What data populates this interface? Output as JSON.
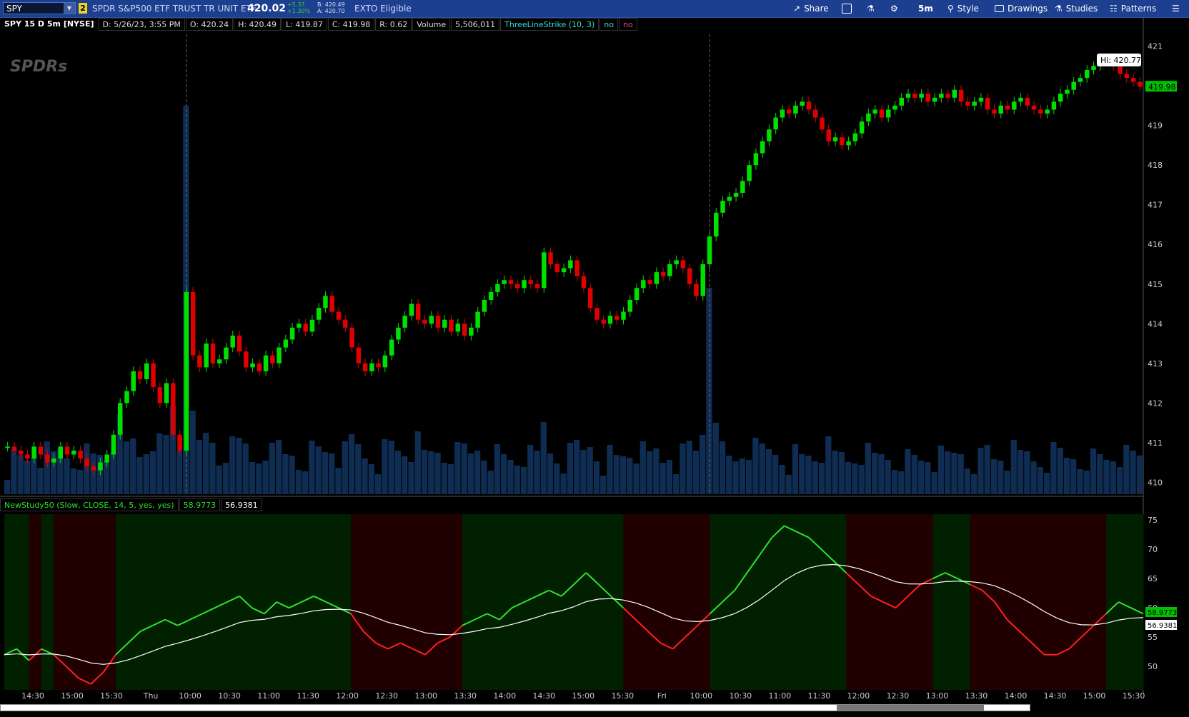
{
  "toolbar": {
    "symbol": "SPY",
    "link_badge": "2",
    "description": "SPDR S&P500 ETF TRUST TR UNIT ETF",
    "last": "420.02",
    "change": "+5.37",
    "change_pct": "+1.30%",
    "bid": "B: 420.49",
    "ask": "A: 420.70",
    "exto": "EXTO Eligible",
    "share": "Share",
    "timeframe": "5m",
    "style": "Style",
    "drawings": "Drawings",
    "studies": "Studies",
    "patterns": "Patterns"
  },
  "infobar": {
    "title": "SPY 15 D 5m [NYSE]",
    "date": "D: 5/26/23, 3:55 PM",
    "open": "O: 420.24",
    "high": "H: 420.49",
    "low": "L: 419.87",
    "close": "C: 419.98",
    "range": "R: 0.62",
    "volume_label": "Volume",
    "volume_value": "5,506,011",
    "study": "ThreeLineStrike (10, 3)",
    "flag1": "no",
    "flag2": "no"
  },
  "logo": "SPDRs",
  "hi_label": "Hi: 420.77",
  "price_tag": "419.98",
  "study_bar": {
    "name": "NewStudy50 (Slow, CLOSE, 14, 5, yes, yes)",
    "value1": "58.9773",
    "value2": "56.9381"
  },
  "colors": {
    "up": "#00e000",
    "down": "#e00000",
    "volume": "#0f2d52",
    "bg_green": "#002000",
    "bg_red": "#200000",
    "line_fast_up": "#30e030",
    "line_fast_down": "#ff2020",
    "line_slow": "#ffffff"
  },
  "chart_data": {
    "type": "candlestick",
    "price_axis": {
      "min": 409.7,
      "max": 421.3,
      "ticks": [
        "410",
        "411",
        "412",
        "413",
        "414",
        "415",
        "416",
        "417",
        "418",
        "419",
        "420",
        "421"
      ]
    },
    "study_axis": {
      "min": 46,
      "max": 76,
      "ticks": [
        "50",
        "55",
        "60",
        "65",
        "70",
        "75"
      ]
    },
    "time_labels": [
      "14:30",
      "15:00",
      "15:30",
      "Thu",
      "10:00",
      "10:30",
      "11:00",
      "11:30",
      "12:00",
      "12:30",
      "13:00",
      "13:30",
      "14:00",
      "14:30",
      "15:00",
      "15:30",
      "Fri",
      "10:00",
      "10:30",
      "11:00",
      "11:30",
      "12:00",
      "12:30",
      "13:00",
      "13:30",
      "14:00",
      "14:30",
      "15:00",
      "15:30"
    ],
    "closes": [
      410.9,
      410.8,
      410.7,
      410.6,
      410.9,
      410.7,
      410.5,
      410.6,
      410.9,
      410.7,
      410.8,
      410.6,
      410.4,
      410.3,
      410.5,
      410.7,
      411.2,
      412.0,
      412.3,
      412.8,
      412.6,
      413.0,
      412.4,
      412.0,
      412.5,
      411.2,
      410.8,
      414.8,
      413.2,
      412.9,
      413.5,
      413.0,
      413.1,
      413.4,
      413.7,
      413.3,
      412.9,
      413.0,
      412.8,
      413.2,
      413.0,
      413.4,
      413.6,
      413.9,
      414.0,
      413.8,
      414.1,
      414.4,
      414.7,
      414.3,
      414.1,
      413.9,
      413.4,
      413.0,
      412.8,
      413.0,
      412.9,
      413.2,
      413.6,
      413.9,
      414.2,
      414.5,
      414.1,
      414.0,
      414.2,
      413.9,
      414.1,
      413.8,
      414.0,
      413.7,
      413.9,
      414.3,
      414.6,
      414.8,
      415.0,
      415.1,
      415.0,
      414.9,
      415.1,
      415.0,
      414.9,
      415.8,
      415.5,
      415.3,
      415.4,
      415.6,
      415.2,
      414.9,
      414.4,
      414.1,
      414.0,
      414.2,
      414.1,
      414.3,
      414.6,
      414.9,
      415.1,
      415.0,
      415.3,
      415.2,
      415.5,
      415.6,
      415.4,
      415.0,
      414.7,
      415.5,
      416.2,
      416.8,
      417.1,
      417.2,
      417.3,
      417.6,
      418.0,
      418.3,
      418.6,
      418.9,
      419.2,
      419.4,
      419.3,
      419.5,
      419.6,
      419.4,
      419.2,
      418.9,
      418.6,
      418.7,
      418.5,
      418.6,
      418.8,
      419.1,
      419.3,
      419.4,
      419.2,
      419.4,
      419.5,
      419.7,
      419.8,
      419.7,
      419.8,
      419.6,
      419.7,
      419.8,
      419.7,
      419.9,
      419.6,
      419.5,
      419.6,
      419.7,
      419.4,
      419.3,
      419.5,
      419.4,
      419.6,
      419.7,
      419.5,
      419.4,
      419.3,
      419.4,
      419.6,
      419.8,
      419.9,
      420.1,
      420.2,
      420.4,
      420.5,
      420.6,
      420.7,
      420.5,
      420.3,
      420.2,
      420.1,
      419.98
    ],
    "study_fast": [
      52,
      53,
      51,
      53,
      52,
      50,
      48,
      47,
      49,
      52,
      54,
      56,
      57,
      58,
      57,
      58,
      59,
      60,
      61,
      62,
      60,
      59,
      61,
      60,
      61,
      62,
      61,
      60,
      59,
      56,
      54,
      53,
      54,
      53,
      52,
      54,
      55,
      57,
      58,
      59,
      58,
      60,
      61,
      62,
      63,
      62,
      64,
      66,
      64,
      62,
      60,
      58,
      56,
      54,
      53,
      55,
      57,
      59,
      61,
      63,
      66,
      69,
      72,
      74,
      73,
      72,
      70,
      68,
      66,
      64,
      62,
      61,
      60,
      62,
      64,
      65,
      66,
      65,
      64,
      63,
      61,
      58,
      56,
      54,
      52,
      52,
      53,
      55,
      57,
      59,
      61,
      60,
      59
    ]
  }
}
